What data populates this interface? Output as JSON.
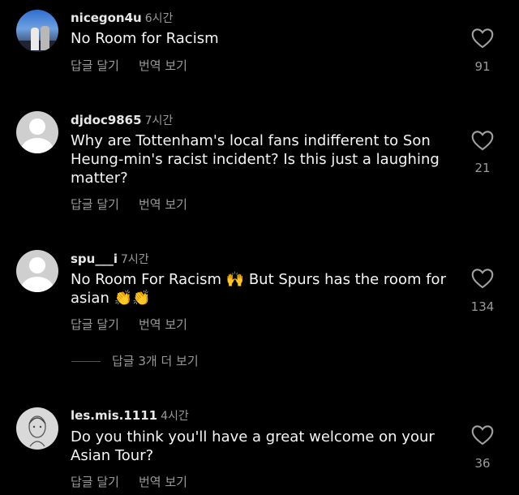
{
  "comments": [
    {
      "username": "nicegon4u",
      "time": "6시간",
      "text": "No Room for Racism",
      "reply": "답글 달기",
      "translate": "번역 보기",
      "likes": "91"
    },
    {
      "username": "djdoc9865",
      "time": "7시간",
      "text": "Why are Tottenham's local fans indifferent to Son Heung-min's racist incident? Is this just a laughing matter?",
      "reply": "답글 달기",
      "translate": "번역 보기",
      "likes": "21"
    },
    {
      "username": "spu___i",
      "time": "7시간",
      "text": "No Room For Racism 🙌 But Spurs has the room for asian 👏👏",
      "reply": "답글 달기",
      "translate": "번역 보기",
      "likes": "134"
    },
    {
      "username": "les.mis.1111",
      "time": "4시간",
      "text": "Do you think you'll have a great welcome on your Asian Tour?",
      "reply": "답글 달기",
      "translate": "번역 보기",
      "likes": "36"
    }
  ],
  "more_replies": "답글 3개 더 보기",
  "icons": {
    "like": "heart-outline-icon"
  },
  "colors": {
    "background": "#000000",
    "text": "#f5f5f5",
    "muted": "#9a9a9a"
  }
}
